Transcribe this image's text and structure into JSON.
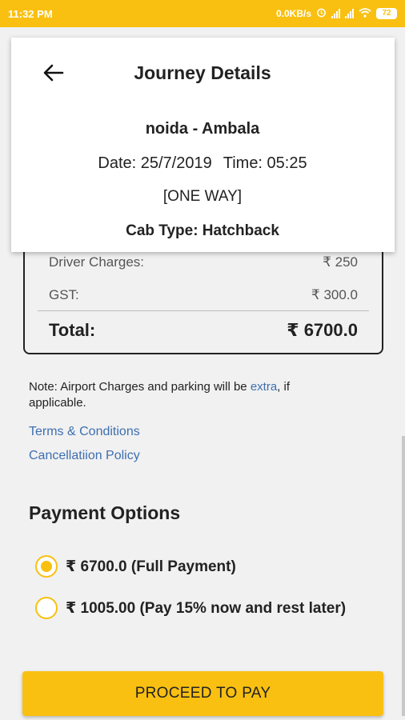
{
  "status_bar": {
    "time": "11:32 PM",
    "network_speed": "0.0KB/s",
    "battery": "72",
    "icons": [
      "alarm-icon",
      "signal-icon",
      "signal-icon",
      "wifi-icon",
      "battery-icon"
    ]
  },
  "header": {
    "title": "Journey Details",
    "back_icon": "arrow-left-icon"
  },
  "journey": {
    "route": "noida  -  Ambala",
    "date": "Date: 25/7/2019",
    "time": "Time: 05:25",
    "trip_mode": "[ONE WAY]",
    "cab_type": "Cab Type: Hatchback"
  },
  "fare": {
    "rows": [
      {
        "label": "Driver Charges:",
        "value": "₹ 250"
      },
      {
        "label": "GST:",
        "value": "₹ 300.0"
      }
    ],
    "total_label": "Total:",
    "total_value": "₹ 6700.0"
  },
  "note": {
    "prefix": "Note: Airport Charges and parking will be ",
    "highlight": "extra",
    "suffix": ", if applicable."
  },
  "links": {
    "terms": "Terms & Conditions",
    "cancellation": "Cancellatiion Policy"
  },
  "payment": {
    "title": "Payment Options",
    "options": [
      {
        "label": "₹ 6700.0 (Full Payment)",
        "selected": true
      },
      {
        "label": "₹ 1005.00 (Pay 15% now and rest later)",
        "selected": false
      }
    ]
  },
  "actions": {
    "proceed_label": "PROCEED TO PAY"
  },
  "colors": {
    "accent": "#f9c012",
    "link": "#3d6fb0",
    "background": "#f1f1f1"
  }
}
